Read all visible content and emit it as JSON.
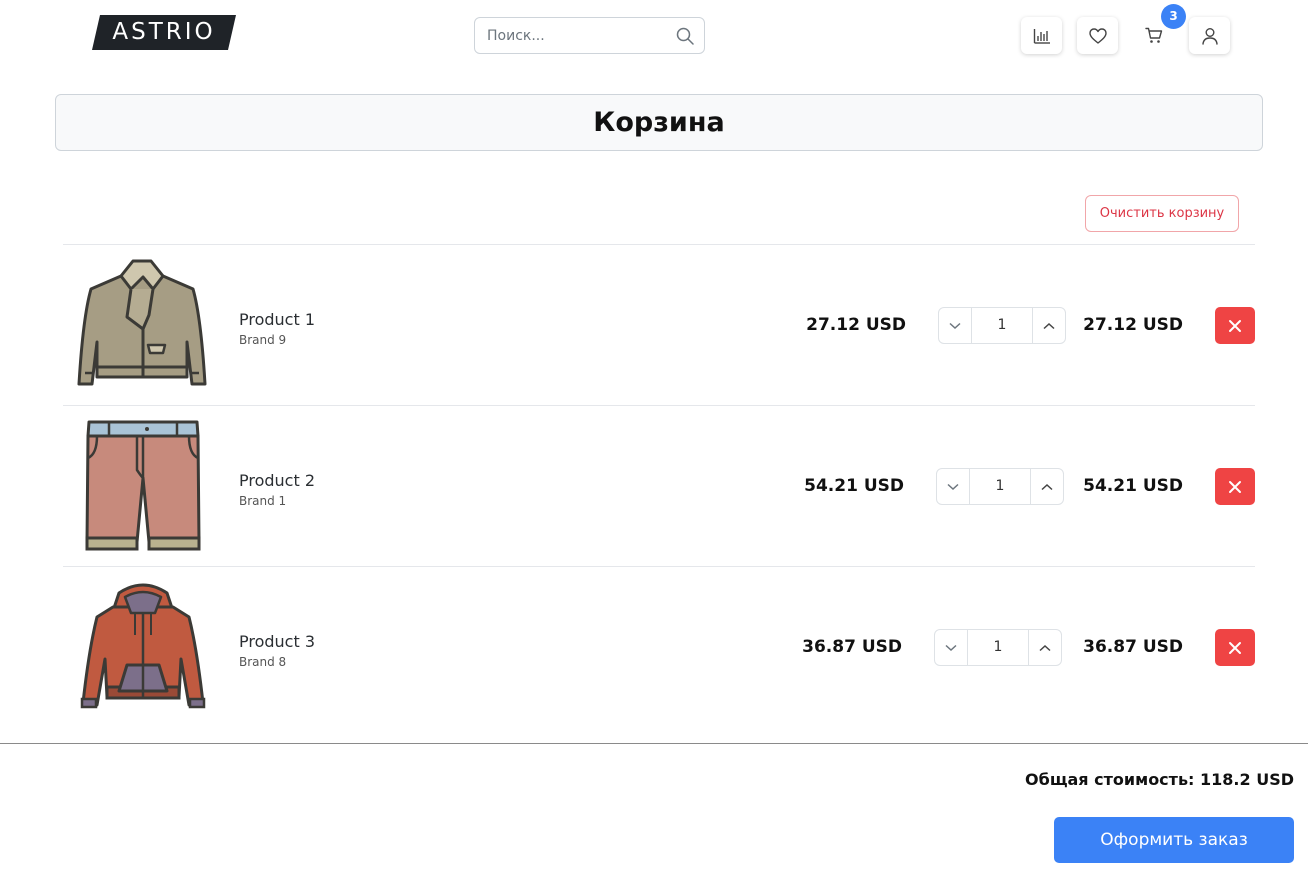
{
  "header": {
    "logo_text": "ASTRIO",
    "search": {
      "placeholder": "Поиск...",
      "value": ""
    },
    "icons": [
      "chart-icon",
      "heart-icon",
      "cart-icon",
      "user-icon"
    ],
    "cart_count": "3"
  },
  "page": {
    "title": "Корзина"
  },
  "cart": {
    "clear_label": "Очистить корзину",
    "items": [
      {
        "name": "Product 1",
        "brand": "Brand 9",
        "price": "27.12 USD",
        "quantity": "1",
        "total": "27.12 USD",
        "image": "jacket-icon"
      },
      {
        "name": "Product 2",
        "brand": "Brand 1",
        "price": "54.21 USD",
        "quantity": "1",
        "total": "54.21 USD",
        "image": "shorts-icon"
      },
      {
        "name": "Product 3",
        "brand": "Brand 8",
        "price": "36.87 USD",
        "quantity": "1",
        "total": "36.87 USD",
        "image": "hoodie-icon"
      }
    ]
  },
  "summary": {
    "total_text": "Общая стоимость: 118.2 USD",
    "checkout_label": "Оформить заказ"
  },
  "colors": {
    "accent": "#3b82f6",
    "danger": "#ef4444",
    "logo_bg": "#1f2328"
  }
}
